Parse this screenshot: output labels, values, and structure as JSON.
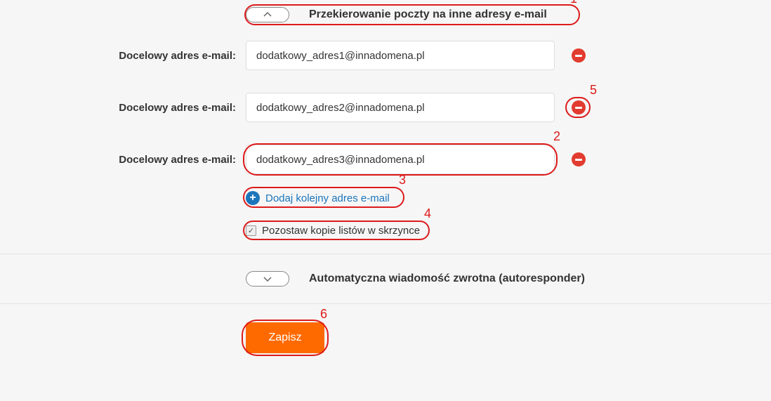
{
  "section1": {
    "title": "Przekierowanie poczty na inne adresy e-mail",
    "toggle_state": "expanded"
  },
  "forward_label": "Docelowy adres e-mail:",
  "forward_rows": [
    {
      "value": "dodatkowy_adres1@innadomena.pl"
    },
    {
      "value": "dodatkowy_adres2@innadomena.pl"
    },
    {
      "value": "dodatkowy_adres3@innadomena.pl"
    }
  ],
  "add_link": {
    "label": "Dodaj kolejny adres e-mail"
  },
  "keep_copy": {
    "label": "Pozostaw kopie listów w skrzynce",
    "checked": true
  },
  "section2": {
    "title": "Automatyczna wiadomość zwrotna (autoresponder)",
    "toggle_state": "collapsed"
  },
  "footer": {
    "save_label": "Zapisz"
  },
  "annotations": {
    "n1": "1",
    "n2": "2",
    "n3": "3",
    "n4": "4",
    "n5": "5",
    "n6": "6"
  },
  "colors": {
    "accent_orange": "#ff6a00",
    "link_blue": "#1b75bb",
    "danger_red": "#e23b2f",
    "annotate_red": "#dd1a1a"
  }
}
